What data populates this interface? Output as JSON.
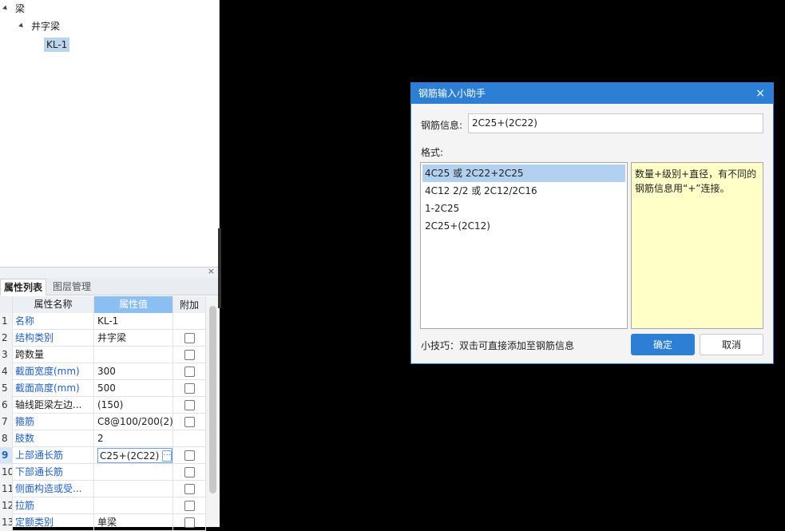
{
  "tree": {
    "root_label": "梁",
    "child_label": "井字梁",
    "leaf_label": "KL-1"
  },
  "panel": {
    "close_glyph": "×",
    "tabs": [
      "属性列表",
      "图层管理"
    ]
  },
  "grid": {
    "headers": {
      "name": "属性名称",
      "value": "属性值",
      "add": "附加"
    },
    "rows": [
      {
        "num": "1",
        "name": "名称",
        "value": "KL-1",
        "blue": true,
        "check": false
      },
      {
        "num": "2",
        "name": "结构类别",
        "value": "井字梁",
        "blue": true,
        "check": true
      },
      {
        "num": "3",
        "name": "跨数量",
        "value": "",
        "blue": false,
        "check": true
      },
      {
        "num": "4",
        "name": "截面宽度(mm)",
        "value": "300",
        "blue": true,
        "check": true
      },
      {
        "num": "5",
        "name": "截面高度(mm)",
        "value": "500",
        "blue": true,
        "check": true
      },
      {
        "num": "6",
        "name": "轴线距梁左边...",
        "value": "(150)",
        "blue": false,
        "check": true
      },
      {
        "num": "7",
        "name": "箍筋",
        "value": "C8@100/200(2)",
        "blue": true,
        "check": true
      },
      {
        "num": "8",
        "name": "肢数",
        "value": "2",
        "blue": true,
        "check": false
      },
      {
        "num": "9",
        "name": "上部通长筋",
        "value": "C25+(2C22)",
        "blue": true,
        "check": true
      },
      {
        "num": "10",
        "name": "下部通长筋",
        "value": "",
        "blue": true,
        "check": true
      },
      {
        "num": "11",
        "name": "侧面构造或受...",
        "value": "",
        "blue": true,
        "check": true
      },
      {
        "num": "12",
        "name": "拉筋",
        "value": "",
        "blue": true,
        "check": true
      },
      {
        "num": "13",
        "name": "定额类别",
        "value": "单梁",
        "blue": true,
        "check": true
      }
    ],
    "ellipsis_glyph": "···"
  },
  "dialog": {
    "title": "钢筋输入小助手",
    "close_glyph": "×",
    "info_label": "钢筋信息:",
    "info_value": "2C25+(2C22)",
    "format_label": "格式:",
    "formats": [
      "4C25 或 2C22+2C25",
      "4C12 2/2 或 2C12/2C16",
      "1-2C25",
      "2C25+(2C12)"
    ],
    "hint": "数量+级别+直径，有不同的钢筋信息用“+”连接。",
    "tip": "小技巧：双击可直接添加至钢筋信息",
    "ok_label": "确定",
    "cancel_label": "取消"
  },
  "colors": {
    "accent": "#2d7fd6",
    "link_text": "#1f5fc4",
    "hint_bg": "#ffffc8",
    "header_value_bg": "#8cbff1"
  }
}
